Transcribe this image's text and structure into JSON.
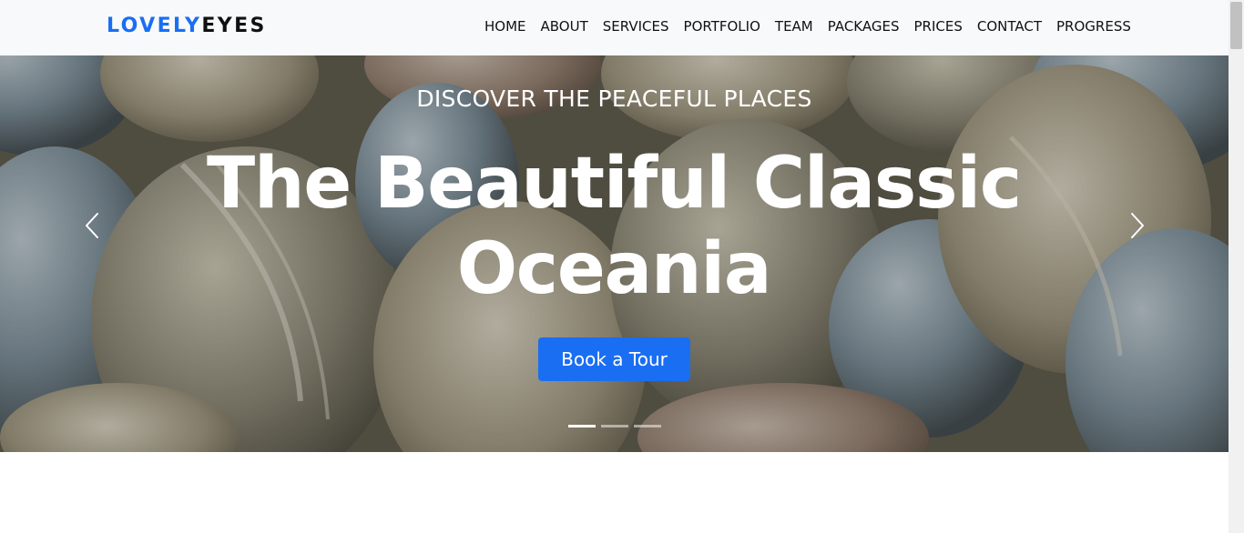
{
  "brand": {
    "part1": "LOVELY",
    "part2": "EYES"
  },
  "nav": [
    "HOME",
    "ABOUT",
    "SERVICES",
    "PORTFOLIO",
    "TEAM",
    "PACKAGES",
    "PRICES",
    "CONTACT",
    "PROGRESS"
  ],
  "hero": {
    "kicker": "DISCOVER THE PEACEFUL PLACES",
    "headline_line1": "The Beautiful Classic",
    "headline_line2": "Oceania",
    "cta": "Book a Tour",
    "slides_total": 3,
    "active_slide": 1
  },
  "colors": {
    "accent": "#1a6ef2",
    "navbar_bg": "#f8f9fa",
    "text_dark": "#111111"
  },
  "icons": {
    "prev": "chevron-left-icon",
    "next": "chevron-right-icon"
  }
}
